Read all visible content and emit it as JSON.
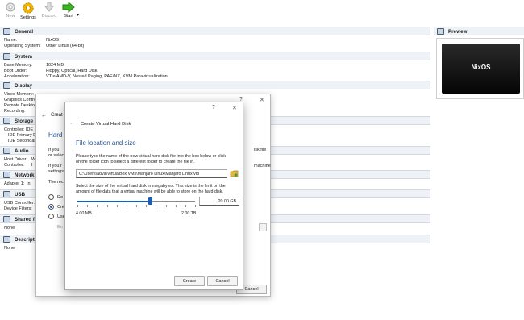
{
  "toolbar": {
    "new_label": "New",
    "settings_label": "Settings",
    "discard_label": "Discard",
    "start_label": "Start"
  },
  "details": {
    "general": {
      "title": "General",
      "name_key": "Name:",
      "name_value": "NixOS",
      "os_key": "Operating System:",
      "os_value": "Other Linux (64-bit)"
    },
    "system": {
      "title": "System",
      "memory_key": "Base Memory:",
      "memory_value": "1024 MB",
      "boot_key": "Boot Order:",
      "boot_value": "Floppy, Optical, Hard Disk",
      "accel_key": "Acceleration:",
      "accel_value": "VT-x/AMD-V, Nested Paging, PAE/NX, KVM Paravirtualization"
    },
    "display": {
      "title": "Display",
      "video_key": "Video Memory:",
      "graphics_key": "Graphics Contro",
      "remote_key": "Remote Desktop",
      "recording_key": "Recording:"
    },
    "storage": {
      "title": "Storage",
      "controller_key": "Controller: IDE",
      "ide_primary": "IDE Primary D",
      "ide_secondary": "IDE Secondary"
    },
    "audio": {
      "title": "Audio",
      "host_key": "Host Driver:",
      "host_value": "W",
      "controller_key": "Controller:",
      "controller_value": "I"
    },
    "network": {
      "title": "Network",
      "adapter": "Adapter 1:",
      "adapter_value": "In"
    },
    "usb": {
      "title": "USB",
      "controller_key": "USB Controller:",
      "filters_key": "Device Filters:"
    },
    "shared": {
      "title": "Shared fo",
      "value": "None"
    },
    "description": {
      "title": "Descripti",
      "value": "None"
    }
  },
  "preview": {
    "title": "Preview",
    "screen_text": "NixOS"
  },
  "back_dialog": {
    "title": "Creat",
    "heading": "Hard d",
    "text_1": "If you",
    "text_2": "or selec",
    "text_3": "If you r",
    "text_4": "settings",
    "text_5": "The rec",
    "text_right_1": "isk file",
    "text_right_2": "machine",
    "radio_1": "Do no",
    "radio_2": "Creat",
    "radio_3": "Use",
    "existing_label": "En",
    "cancel_label": "Cancel",
    "help_glyph": "?",
    "close_glyph": "✕"
  },
  "front_dialog": {
    "title": "Create Virtual Hard Disk",
    "heading": "File location and size",
    "desc_1": "Please type the name of the new virtual hard disk file into the box below or click",
    "desc_2": "on the folder icon to select a different folder to create the file in.",
    "path_value": "C:\\Users\\adva\\VirtualBox VMs\\Manjaro Linux\\Manjaro Linux.vdi",
    "size_desc_1": "Select the size of the virtual hard disk in megabytes. This size is the limit on the",
    "size_desc_2": "amount of file data that a virtual machine will be able to store on the hard disk.",
    "size_value": "20.00 GB",
    "slider_fraction": 0.62,
    "slider_min": "4.00 MB",
    "slider_max": "2.00 TB",
    "create_label": "Create",
    "cancel_label": "Cancel",
    "help_glyph": "?",
    "close_glyph": "✕"
  },
  "colors": {
    "accent": "#1a5fb4",
    "heading": "#1f4e8c",
    "section_bg": "#eef1f5"
  }
}
